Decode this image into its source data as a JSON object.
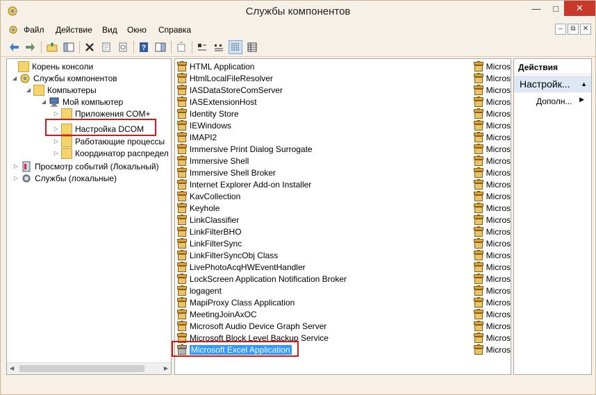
{
  "window": {
    "title": "Службы компонентов"
  },
  "menu": {
    "items": [
      "Файл",
      "Действие",
      "Вид",
      "Окно",
      "Справка"
    ]
  },
  "tree": [
    {
      "label": "Корень консоли",
      "level": 0,
      "expander": ""
    },
    {
      "label": "Службы компонентов",
      "level": 1,
      "expander": "◢"
    },
    {
      "label": "Компьютеры",
      "level": 2,
      "expander": "◢"
    },
    {
      "label": "Мой компьютер",
      "level": 3,
      "expander": "◢"
    },
    {
      "label": "Приложения COM+",
      "level": 4,
      "expander": "▷"
    },
    {
      "label": "Настройка DCOM",
      "level": 4,
      "expander": "▷"
    },
    {
      "label": "Работающие процессы",
      "level": 4,
      "expander": "▷"
    },
    {
      "label": "Координатор распредел",
      "level": 4,
      "expander": "▷"
    },
    {
      "label": "Просмотр событий (Локальный)",
      "level": 0,
      "expander": "▷"
    },
    {
      "label": "Службы (локальные)",
      "level": 0,
      "expander": "▷"
    }
  ],
  "list": {
    "vendor": "Micros",
    "selected_index": 24,
    "items": [
      "HTML Application",
      "HtmlLocalFileResolver",
      "IASDataStoreComServer",
      "IASExtensionHost",
      "Identity Store",
      "IEWindows",
      "IMAPI2",
      "Immersive Print Dialog Surrogate",
      "Immersive Shell",
      "Immersive Shell Broker",
      "Internet Explorer Add-on Installer",
      "KavCollection",
      "Keyhole",
      "LinkClassifier",
      "LinkFilterBHO",
      "LinkFilterSync",
      "LinkFilterSyncObj Class",
      "LivePhotoAcqHWEventHandler",
      "LockScreen Application Notification Broker",
      "logagent",
      "MapiProxy Class Application",
      "MeetingJoinAxOC",
      "Microsoft Audio Device Graph Server",
      "Microsoft Block Level Backup Service",
      "Microsoft Excel Application"
    ]
  },
  "actions": {
    "header": "Действия",
    "section": "Настройк...",
    "item": "Дополн..."
  },
  "colors": {
    "selection": "#3399ff",
    "highlight_box": "#d91515",
    "close_button": "#c7392b"
  }
}
